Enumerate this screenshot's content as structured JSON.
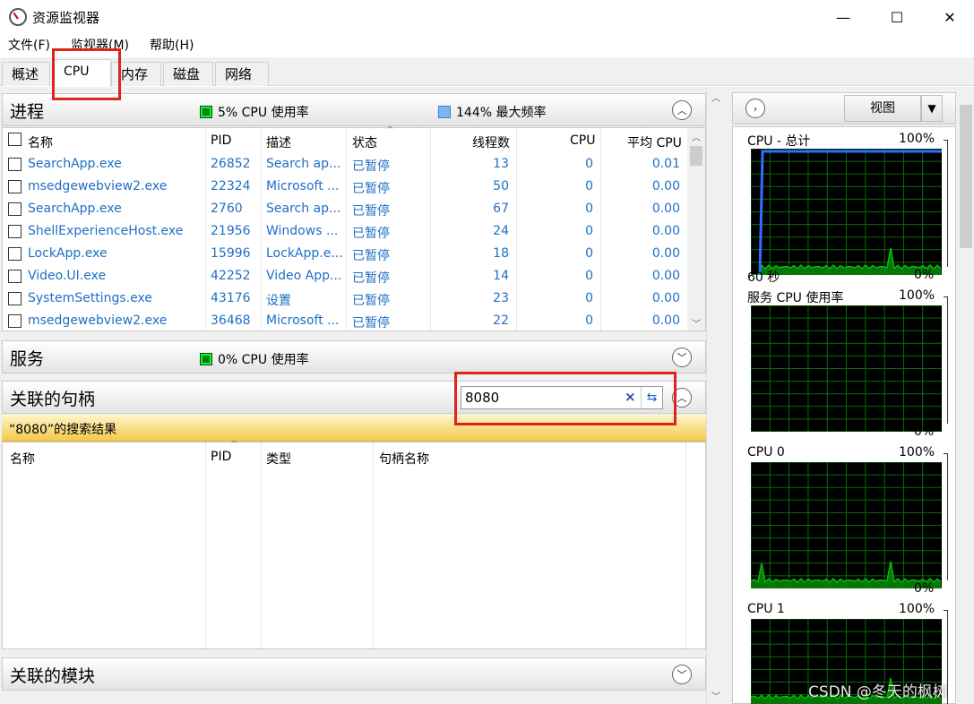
{
  "window": {
    "title": "资源监视器",
    "minimize": "—",
    "maximize": "☐",
    "close": "✕"
  },
  "menu": [
    "文件(F)",
    "监视器(M)",
    "帮助(H)"
  ],
  "tabs": [
    "概述",
    "CPU",
    "内存",
    "磁盘",
    "网络"
  ],
  "active_tab": "CPU",
  "processes": {
    "title": "进程",
    "cpu_usage": "5% CPU 使用率",
    "max_freq": "144% 最大频率",
    "columns": [
      "名称",
      "PID",
      "描述",
      "状态",
      "线程数",
      "CPU",
      "平均 CPU"
    ],
    "rows": [
      {
        "name": "SearchApp.exe",
        "pid": "26852",
        "desc": "Search ap...",
        "status": "已暂停",
        "threads": "13",
        "cpu": "0",
        "avg": "0.01"
      },
      {
        "name": "msedgewebview2.exe",
        "pid": "22324",
        "desc": "Microsoft ...",
        "status": "已暂停",
        "threads": "50",
        "cpu": "0",
        "avg": "0.00"
      },
      {
        "name": "SearchApp.exe",
        "pid": "2760",
        "desc": "Search ap...",
        "status": "已暂停",
        "threads": "67",
        "cpu": "0",
        "avg": "0.00"
      },
      {
        "name": "ShellExperienceHost.exe",
        "pid": "21956",
        "desc": "Windows ...",
        "status": "已暂停",
        "threads": "24",
        "cpu": "0",
        "avg": "0.00"
      },
      {
        "name": "LockApp.exe",
        "pid": "15996",
        "desc": "LockApp.e...",
        "status": "已暂停",
        "threads": "18",
        "cpu": "0",
        "avg": "0.00"
      },
      {
        "name": "Video.UI.exe",
        "pid": "42252",
        "desc": "Video App...",
        "status": "已暂停",
        "threads": "14",
        "cpu": "0",
        "avg": "0.00"
      },
      {
        "name": "SystemSettings.exe",
        "pid": "43176",
        "desc": "设置",
        "status": "已暂停",
        "threads": "23",
        "cpu": "0",
        "avg": "0.00"
      },
      {
        "name": "msedgewebview2.exe",
        "pid": "36468",
        "desc": "Microsoft ...",
        "status": "已暂停",
        "threads": "22",
        "cpu": "0",
        "avg": "0.00"
      }
    ]
  },
  "services": {
    "title": "服务",
    "cpu_usage": "0% CPU 使用率"
  },
  "handles": {
    "title": "关联的句柄",
    "search_value": "8080",
    "results_label": "“8080”的搜索结果",
    "columns": [
      "名称",
      "PID",
      "类型",
      "句柄名称"
    ]
  },
  "modules": {
    "title": "关联的模块"
  },
  "right_panel": {
    "view_label": "视图",
    "graphs": [
      {
        "title": "CPU - 总计",
        "max": "100%",
        "bottom_left": "60 秒",
        "min": "0%"
      },
      {
        "title": "服务 CPU 使用率",
        "max": "100%",
        "bottom_left": "",
        "min": "0%"
      },
      {
        "title": "CPU 0",
        "max": "100%",
        "bottom_left": "",
        "min": "0%"
      },
      {
        "title": "CPU 1",
        "max": "100%",
        "bottom_left": "",
        "min": ""
      }
    ]
  },
  "watermark": "CSDN @冬天的枫树",
  "colors": {
    "highlight_red": "#e0241b",
    "process_link_blue": "#1f6fc4",
    "graph_green": "#00c000",
    "graph_blue": "#2f6fff"
  }
}
